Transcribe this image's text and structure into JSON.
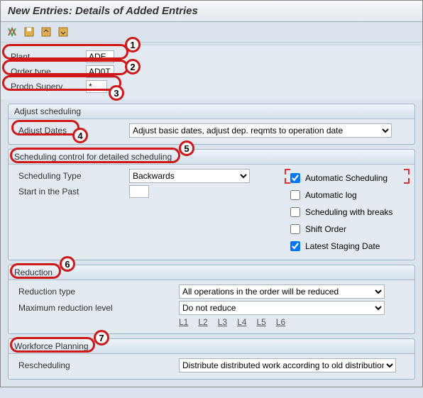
{
  "title": "New Entries: Details of Added Entries",
  "form": {
    "plant_label": "Plant",
    "plant_value": "ADE",
    "order_type_label": "Order type",
    "order_type_value": "AD0T",
    "prodn_superv_label": "Prodn Superv.",
    "prodn_superv_value": "*"
  },
  "adjust_scheduling": {
    "title": "Adjust scheduling",
    "adjust_dates_label": "Adjust Dates",
    "adjust_dates_value": "Adjust basic dates, adjust dep. reqmts to operation date"
  },
  "scheduling_control": {
    "title": "Scheduling control for detailed scheduling",
    "scheduling_type_label": "Scheduling Type",
    "scheduling_type_value": "Backwards",
    "start_past_label": "Start in the Past",
    "start_past_value": "",
    "chk_auto_sched": "Automatic Scheduling",
    "chk_auto_log": "Automatic log",
    "chk_breaks": "Scheduling with breaks",
    "chk_shift": "Shift Order",
    "chk_latest": "Latest Staging Date"
  },
  "reduction": {
    "title": "Reduction",
    "type_label": "Reduction type",
    "type_value": "All operations in the order will be reduced",
    "max_label": "Maximum reduction level",
    "max_value": "Do not reduce",
    "levels": [
      "L1",
      "L2",
      "L3",
      "L4",
      "L5",
      "L6"
    ]
  },
  "workforce": {
    "title": "Workforce Planning",
    "resched_label": "Rescheduling",
    "resched_value": "Distribute distributed work according to old distribution"
  },
  "callouts": {
    "c1": "1",
    "c2": "2",
    "c3": "3",
    "c4": "4",
    "c5": "5",
    "c6": "6",
    "c7": "7"
  },
  "chart_data": null
}
